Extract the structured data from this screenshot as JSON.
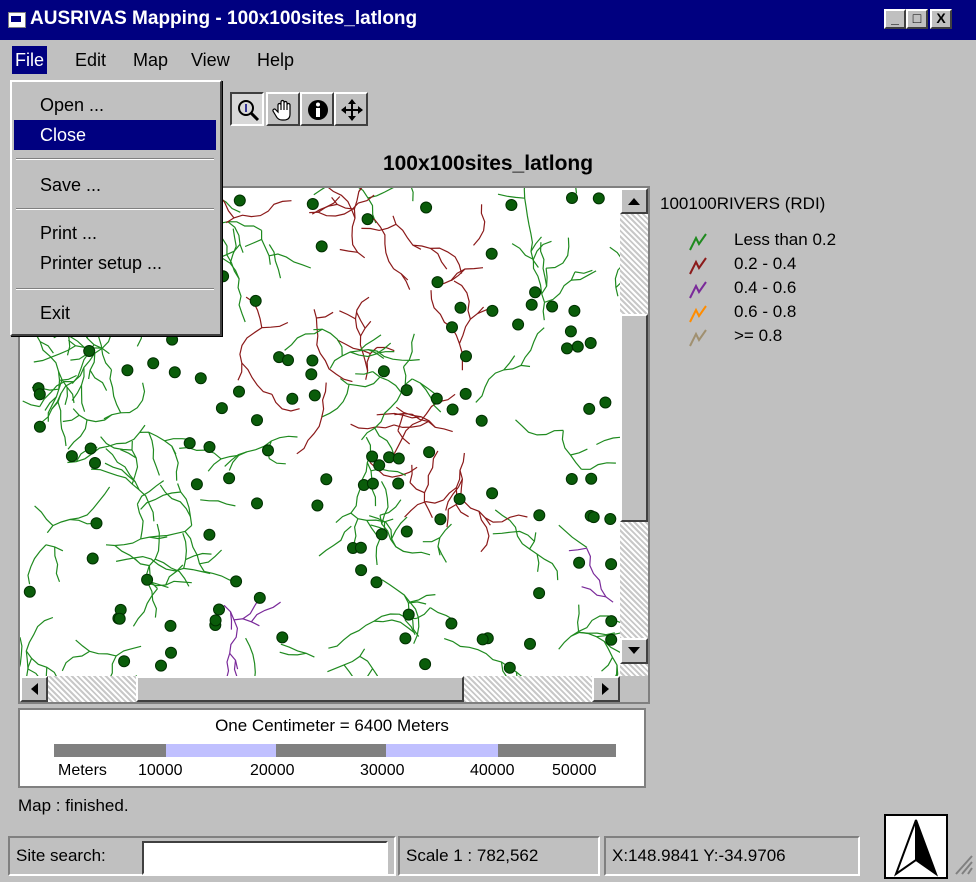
{
  "window": {
    "title": "AUSRIVAS Mapping - 100x100sites_latlong",
    "controls": [
      "_",
      "□",
      "X"
    ]
  },
  "menubar": [
    "File",
    "Edit",
    "Map",
    "View",
    "Help"
  ],
  "file_menu": {
    "items": [
      "Open ...",
      "Close",
      "Save ...",
      "Print ...",
      "Printer setup ...",
      "Exit"
    ],
    "selected": "Close"
  },
  "toolbar": {
    "tools": [
      "zoom-in-icon",
      "pan-hand-icon",
      "info-icon",
      "move-icon"
    ],
    "active_tool": "zoom-in-icon"
  },
  "map": {
    "title": "100x100sites_latlong",
    "site_color": "#0a5c0a",
    "sites_shown": true
  },
  "legend": {
    "title": "100100RIVERS (RDI)",
    "entries": [
      {
        "label": "Less than 0.2",
        "color": "#1f8a1f"
      },
      {
        "label": "0.2 - 0.4",
        "color": "#8b1a1a"
      },
      {
        "label": "0.4 - 0.6",
        "color": "#7a2a9a"
      },
      {
        "label": "0.6 - 0.8",
        "color": "#ff8c00"
      },
      {
        "label": ">= 0.8",
        "color": "#a09070"
      }
    ]
  },
  "scalebar": {
    "caption": "One Centimeter = 6400 Meters",
    "unit_label": "Meters",
    "ticks": [
      "10000",
      "20000",
      "30000",
      "40000",
      "50000"
    ],
    "colors": [
      "#808080",
      "#c0c0ff"
    ]
  },
  "status": {
    "message": "Map : finished.",
    "search_label": "Site search:",
    "search_value": "",
    "scale": "Scale 1 : 782,562",
    "coords": "X:148.9841  Y:-34.9706"
  }
}
